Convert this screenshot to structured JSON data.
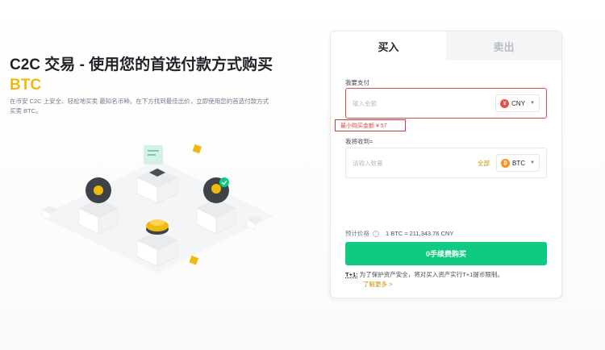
{
  "hero": {
    "title_prefix": "C2C 交易 - 使用您的首选付款方式购买 ",
    "title_accent": "BTC",
    "description": "在币安 C2C 上安全、轻松地买卖 最知名币种。在下方找到最佳出价，立即使用您的首选付款方式买卖 BTC。"
  },
  "tabs": [
    {
      "label": "买入",
      "active": true
    },
    {
      "label": "卖出",
      "active": false
    }
  ],
  "pay": {
    "label": "我要支付",
    "placeholder": "输入金额",
    "currency": "CNY",
    "currency_glyph": "¥",
    "min_amount": "最小购买金额 ¥ 57"
  },
  "receive": {
    "label": "我将收到≈",
    "placeholder": "请输入数量",
    "all_label": "全部",
    "currency": "BTC",
    "currency_glyph": "₿"
  },
  "price": {
    "label": "预计价格",
    "value": "1 BTC ≈ 211,343.76 CNY"
  },
  "buy_button": "0手续费购买",
  "notice": {
    "tag": "T+1:",
    "text": " 为了保护资产安全，将对买入资产实行T+1提币限制。",
    "learn_more": "了解更多 >"
  },
  "colors": {
    "accent": "#f0b90b",
    "buy_green": "#0ecb81",
    "error_red": "#d64b4b"
  }
}
